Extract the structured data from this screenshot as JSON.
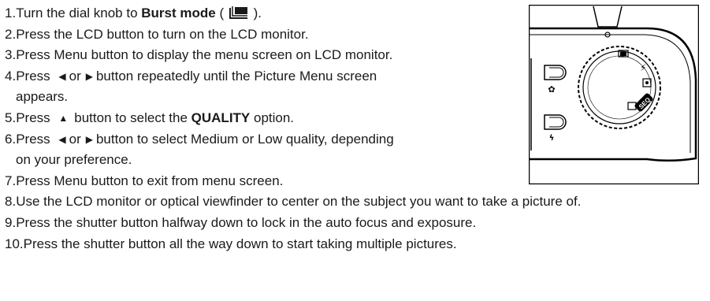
{
  "steps": [
    {
      "num": "1.",
      "a": "Turn the dial knob to ",
      "b": "Burst mode",
      "c": " ( ",
      "d": " )."
    },
    {
      "num": "2.",
      "text": "Press the LCD button to turn on the LCD monitor."
    },
    {
      "num": "3.",
      "text": "Press Menu button to display the menu screen on LCD monitor."
    },
    {
      "num": "4.",
      "a": "Press ",
      "b": "or",
      "c": "button repeatedly until the Picture Menu screen",
      "cont": "appears."
    },
    {
      "num": "5.",
      "a": "Press ",
      "b": "button to select the ",
      "bold": "QUALITY",
      "c": " option."
    },
    {
      "num": "6.",
      "a": "Press ",
      "b": "or",
      "c": "button to select Medium or Low quality, depending",
      "cont": "on your preference."
    },
    {
      "num": "7.",
      "text": "Press Menu button to exit from menu screen."
    },
    {
      "num": "8.",
      "text": "Use the LCD monitor or optical viewfinder to center on the subject you want to take a picture of."
    },
    {
      "num": "9.",
      "text": "Press the shutter button halfway down to lock in the auto focus and exposure."
    },
    {
      "num": "10.",
      "text": "Press the shutter button all the way down to start taking multiple pictures."
    }
  ],
  "icons": {
    "left": "◀",
    "right": "▶",
    "up": "▲"
  },
  "camera": {
    "dial_label": "SEQ"
  }
}
